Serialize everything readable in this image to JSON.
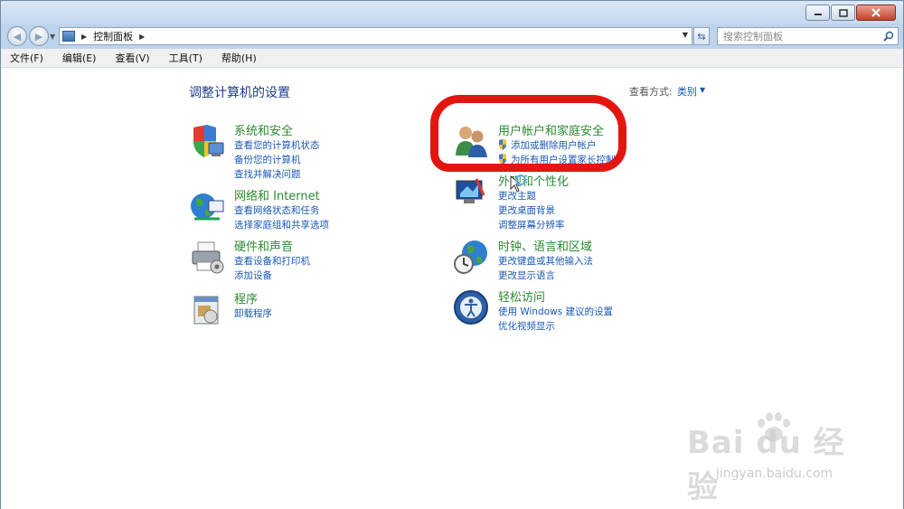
{
  "window": {
    "address": {
      "path": "控制面板"
    },
    "search": {
      "placeholder": "搜索控制面板"
    }
  },
  "menu": [
    "文件(F)",
    "编辑(E)",
    "查看(V)",
    "工具(T)",
    "帮助(H)"
  ],
  "page": {
    "title": "调整计算机的设置",
    "view_label": "查看方式:",
    "view_value": "类别"
  },
  "categories": [
    {
      "title": "系统和安全",
      "icon": "security-shield-icon",
      "links": [
        "查看您的计算机状态",
        "备份您的计算机",
        "查找并解决问题"
      ]
    },
    {
      "title": "网络和 Internet",
      "icon": "network-globe-icon",
      "links": [
        "查看网络状态和任务",
        "选择家庭组和共享选项"
      ]
    },
    {
      "title": "硬件和声音",
      "icon": "printer-icon",
      "links": [
        "查看设备和打印机",
        "添加设备"
      ]
    },
    {
      "title": "程序",
      "icon": "programs-icon",
      "links": [
        "卸载程序"
      ]
    },
    {
      "title": "用户帐户和家庭安全",
      "icon": "users-icon",
      "links": [
        "添加或删除用户帐户",
        "为所有用户设置家长控制"
      ]
    },
    {
      "title": "外观和个性化",
      "icon": "display-icon",
      "links": [
        "更改主题",
        "更改桌面背景",
        "调整屏幕分辨率"
      ]
    },
    {
      "title": "时钟、语言和区域",
      "icon": "clock-globe-icon",
      "links": [
        "更改键盘或其他输入法",
        "更改显示语言"
      ]
    },
    {
      "title": "轻松访问",
      "icon": "accessibility-icon",
      "links": [
        "使用 Windows 建议的设置",
        "优化视频显示"
      ]
    }
  ],
  "watermark": {
    "main": "Bai du 经验",
    "url": "jingyan.baidu.com"
  },
  "colors": {
    "category_title": "#2b8a32",
    "link": "#1a58b4",
    "annotation": "#e3160f"
  }
}
